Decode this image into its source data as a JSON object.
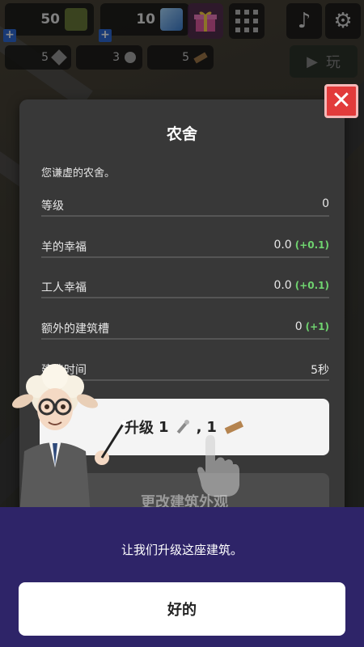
{
  "hud": {
    "cash": "50",
    "gems": "10",
    "plus": "+",
    "resources": [
      "5",
      "3",
      "5"
    ],
    "play_label": "玩"
  },
  "dialog": {
    "title": "农舍",
    "description": "您谦虚的农舍。",
    "stats": [
      {
        "label": "等级",
        "value": "0",
        "delta": ""
      },
      {
        "label": "羊的幸福",
        "value": "0.0",
        "delta": "(+0.1)"
      },
      {
        "label": "工人幸福",
        "value": "0.0",
        "delta": "(+0.1)"
      },
      {
        "label": "额外的建筑槽",
        "value": "0",
        "delta": "(+1)"
      },
      {
        "label": "建造时间",
        "value": "5秒",
        "delta": ""
      }
    ],
    "upgrade": {
      "label": "升级",
      "cost1": "1",
      "sep": ",",
      "cost2": "1"
    },
    "change_label": "更改建筑外观",
    "close_symbol": "✕"
  },
  "tutorial": {
    "text": "让我们升级这座建筑。",
    "ok_label": "好的"
  },
  "colors": {
    "panel": "#383838",
    "tutorial_bg": "#2e2468",
    "close_red": "#e23b3b",
    "delta_green": "#6fd36f",
    "plus_blue": "#2f6bd8"
  }
}
